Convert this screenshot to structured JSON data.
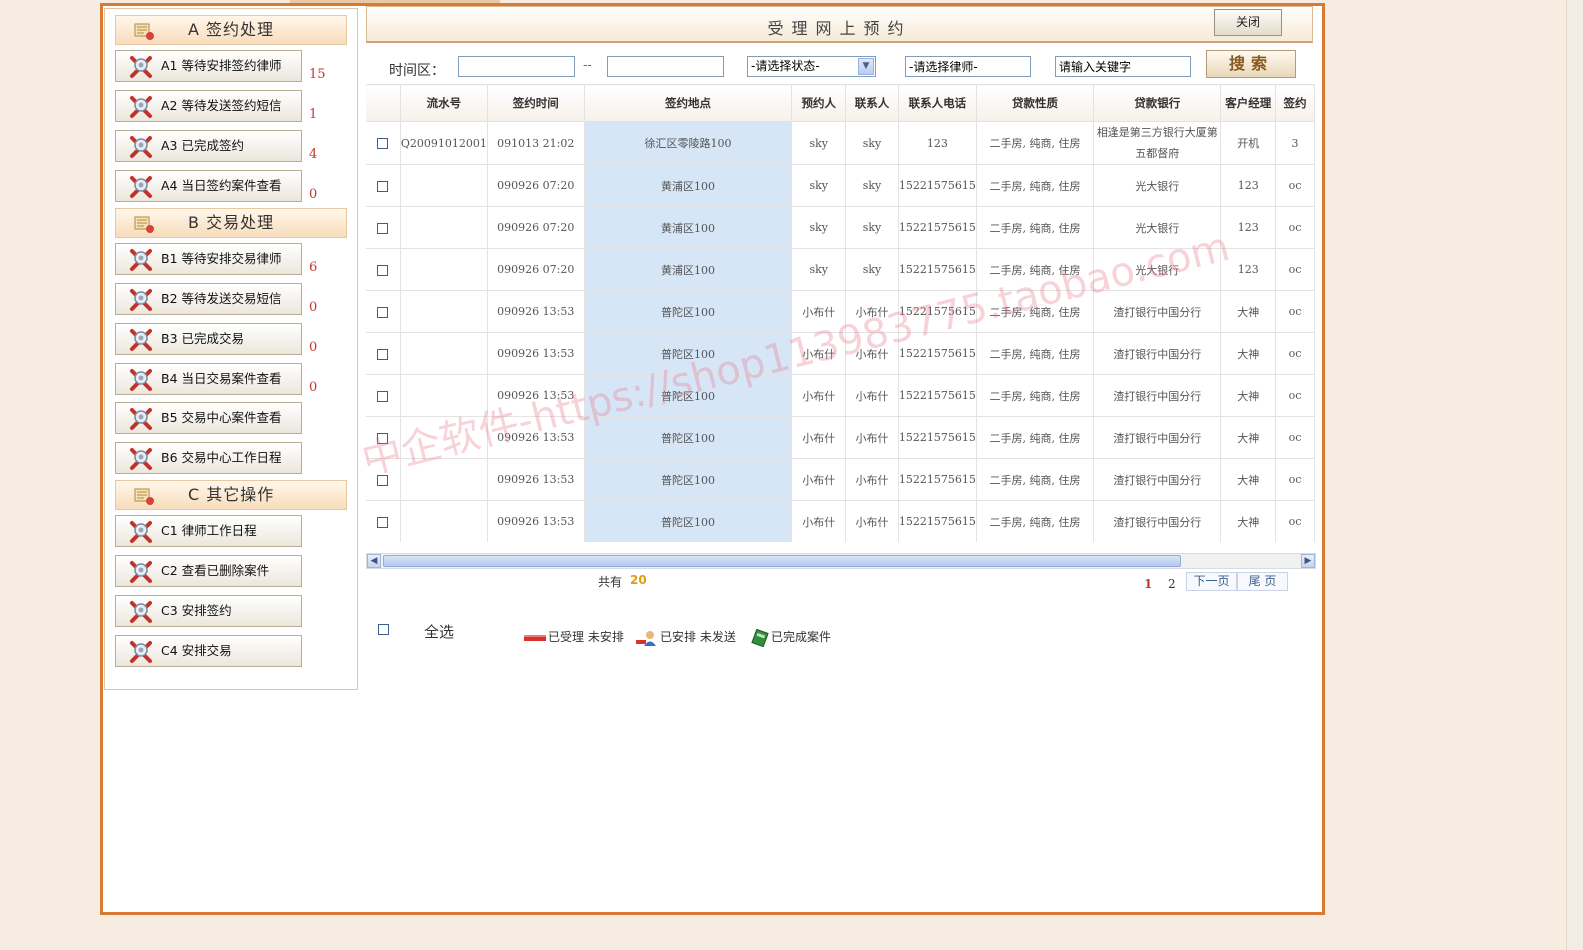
{
  "sidebar": {
    "sections": [
      {
        "title": "A  签约处理",
        "items": [
          {
            "label": "A1  等待安排签约律师",
            "count": "15"
          },
          {
            "label": "A2  等待发送签约短信",
            "count": "1"
          },
          {
            "label": "A3  已完成签约",
            "count": "4"
          },
          {
            "label": "A4  当日签约案件查看",
            "count": "0"
          }
        ]
      },
      {
        "title": "B  交易处理",
        "items": [
          {
            "label": "B1  等待安排交易律师",
            "count": "6"
          },
          {
            "label": "B2  等待发送交易短信",
            "count": "0"
          },
          {
            "label": "B3  已完成交易",
            "count": "0"
          },
          {
            "label": "B4  当日交易案件查看",
            "count": "0"
          },
          {
            "label": "B5  交易中心案件查看",
            "count": ""
          },
          {
            "label": "B6  交易中心工作日程",
            "count": ""
          }
        ]
      },
      {
        "title": "C  其它操作",
        "items": [
          {
            "label": "C1  律师工作日程",
            "count": ""
          },
          {
            "label": "C2  查看已删除案件",
            "count": ""
          },
          {
            "label": "C3  安排签约",
            "count": ""
          },
          {
            "label": "C4  安排交易",
            "count": ""
          }
        ]
      }
    ]
  },
  "main": {
    "title": "受理网上预约",
    "close_label": "关闭"
  },
  "filter": {
    "time_label": "时间区：",
    "date_from": "",
    "date_to": "",
    "separator": "--",
    "status_selected": "-请选择状态-",
    "lawyer_value": "-请选择律师-",
    "keyword_value": "请输入关键字",
    "search_label": "搜索"
  },
  "table": {
    "columns": [
      "流水号",
      "签约时间",
      "签约地点",
      "预约人",
      "联系人",
      "联系人电话",
      "贷款性质",
      "贷款银行",
      "客户经理",
      "签约"
    ],
    "rows": [
      {
        "serial": "Q20091012001",
        "time": "091013 21:02",
        "location": "徐汇区零陵路100",
        "booker": "sky",
        "contact": "sky",
        "phone": "123",
        "loan_type": "二手房, 纯商, 住房",
        "bank": "相逢是第三方银行大厦第五都督府",
        "manager": "开机",
        "extra": "3"
      },
      {
        "serial": "",
        "time": "090926 07:20",
        "location": "黄浦区100",
        "booker": "sky",
        "contact": "sky",
        "phone": "15221575615",
        "loan_type": "二手房, 纯商, 住房",
        "bank": "光大银行",
        "manager": "123",
        "extra": "oc"
      },
      {
        "serial": "",
        "time": "090926 07:20",
        "location": "黄浦区100",
        "booker": "sky",
        "contact": "sky",
        "phone": "15221575615",
        "loan_type": "二手房, 纯商, 住房",
        "bank": "光大银行",
        "manager": "123",
        "extra": "oc"
      },
      {
        "serial": "",
        "time": "090926 07:20",
        "location": "黄浦区100",
        "booker": "sky",
        "contact": "sky",
        "phone": "15221575615",
        "loan_type": "二手房, 纯商, 住房",
        "bank": "光大银行",
        "manager": "123",
        "extra": "oc"
      },
      {
        "serial": "",
        "time": "090926 13:53",
        "location": "普陀区100",
        "booker": "小布什",
        "contact": "小布什",
        "phone": "15221575615",
        "loan_type": "二手房, 纯商, 住房",
        "bank": "渣打银行中国分行",
        "manager": "大神",
        "extra": "oc"
      },
      {
        "serial": "",
        "time": "090926 13:53",
        "location": "普陀区100",
        "booker": "小布什",
        "contact": "小布什",
        "phone": "15221575615",
        "loan_type": "二手房, 纯商, 住房",
        "bank": "渣打银行中国分行",
        "manager": "大神",
        "extra": "oc"
      },
      {
        "serial": "",
        "time": "090926 13:53",
        "location": "普陀区100",
        "booker": "小布什",
        "contact": "小布什",
        "phone": "15221575615",
        "loan_type": "二手房, 纯商, 住房",
        "bank": "渣打银行中国分行",
        "manager": "大神",
        "extra": "oc"
      },
      {
        "serial": "",
        "time": "090926 13:53",
        "location": "普陀区100",
        "booker": "小布什",
        "contact": "小布什",
        "phone": "15221575615",
        "loan_type": "二手房, 纯商, 住房",
        "bank": "渣打银行中国分行",
        "manager": "大神",
        "extra": "oc"
      },
      {
        "serial": "",
        "time": "090926 13:53",
        "location": "普陀区100",
        "booker": "小布什",
        "contact": "小布什",
        "phone": "15221575615",
        "loan_type": "二手房, 纯商, 住房",
        "bank": "渣打银行中国分行",
        "manager": "大神",
        "extra": "oc"
      },
      {
        "serial": "",
        "time": "090926 13:53",
        "location": "普陀区100",
        "booker": "小布什",
        "contact": "小布什",
        "phone": "15221575615",
        "loan_type": "二手房, 纯商, 住房",
        "bank": "渣打银行中国分行",
        "manager": "大神",
        "extra": "oc"
      }
    ]
  },
  "pagination": {
    "total_label": "共有",
    "total_count": "20",
    "current_page": "1",
    "page_2": "2",
    "next_label": "下一页",
    "last_label": "尾 页"
  },
  "footer": {
    "select_all_label": "全选",
    "legend": [
      {
        "label": "已受理  未安排",
        "icon": "red-bar-icon"
      },
      {
        "label": "已安排  未发送",
        "icon": "person-icon"
      },
      {
        "label": "已完成案件",
        "icon": "green-card-icon"
      }
    ]
  },
  "watermark": "中企软件-https://shop113983775.taobao.com",
  "colors": {
    "frame_border": "#d97a32",
    "page_background": "#f6ece1",
    "location_cell": "#d6e6f7",
    "count_red": "#c0392b",
    "total_orange": "#e19b19"
  }
}
